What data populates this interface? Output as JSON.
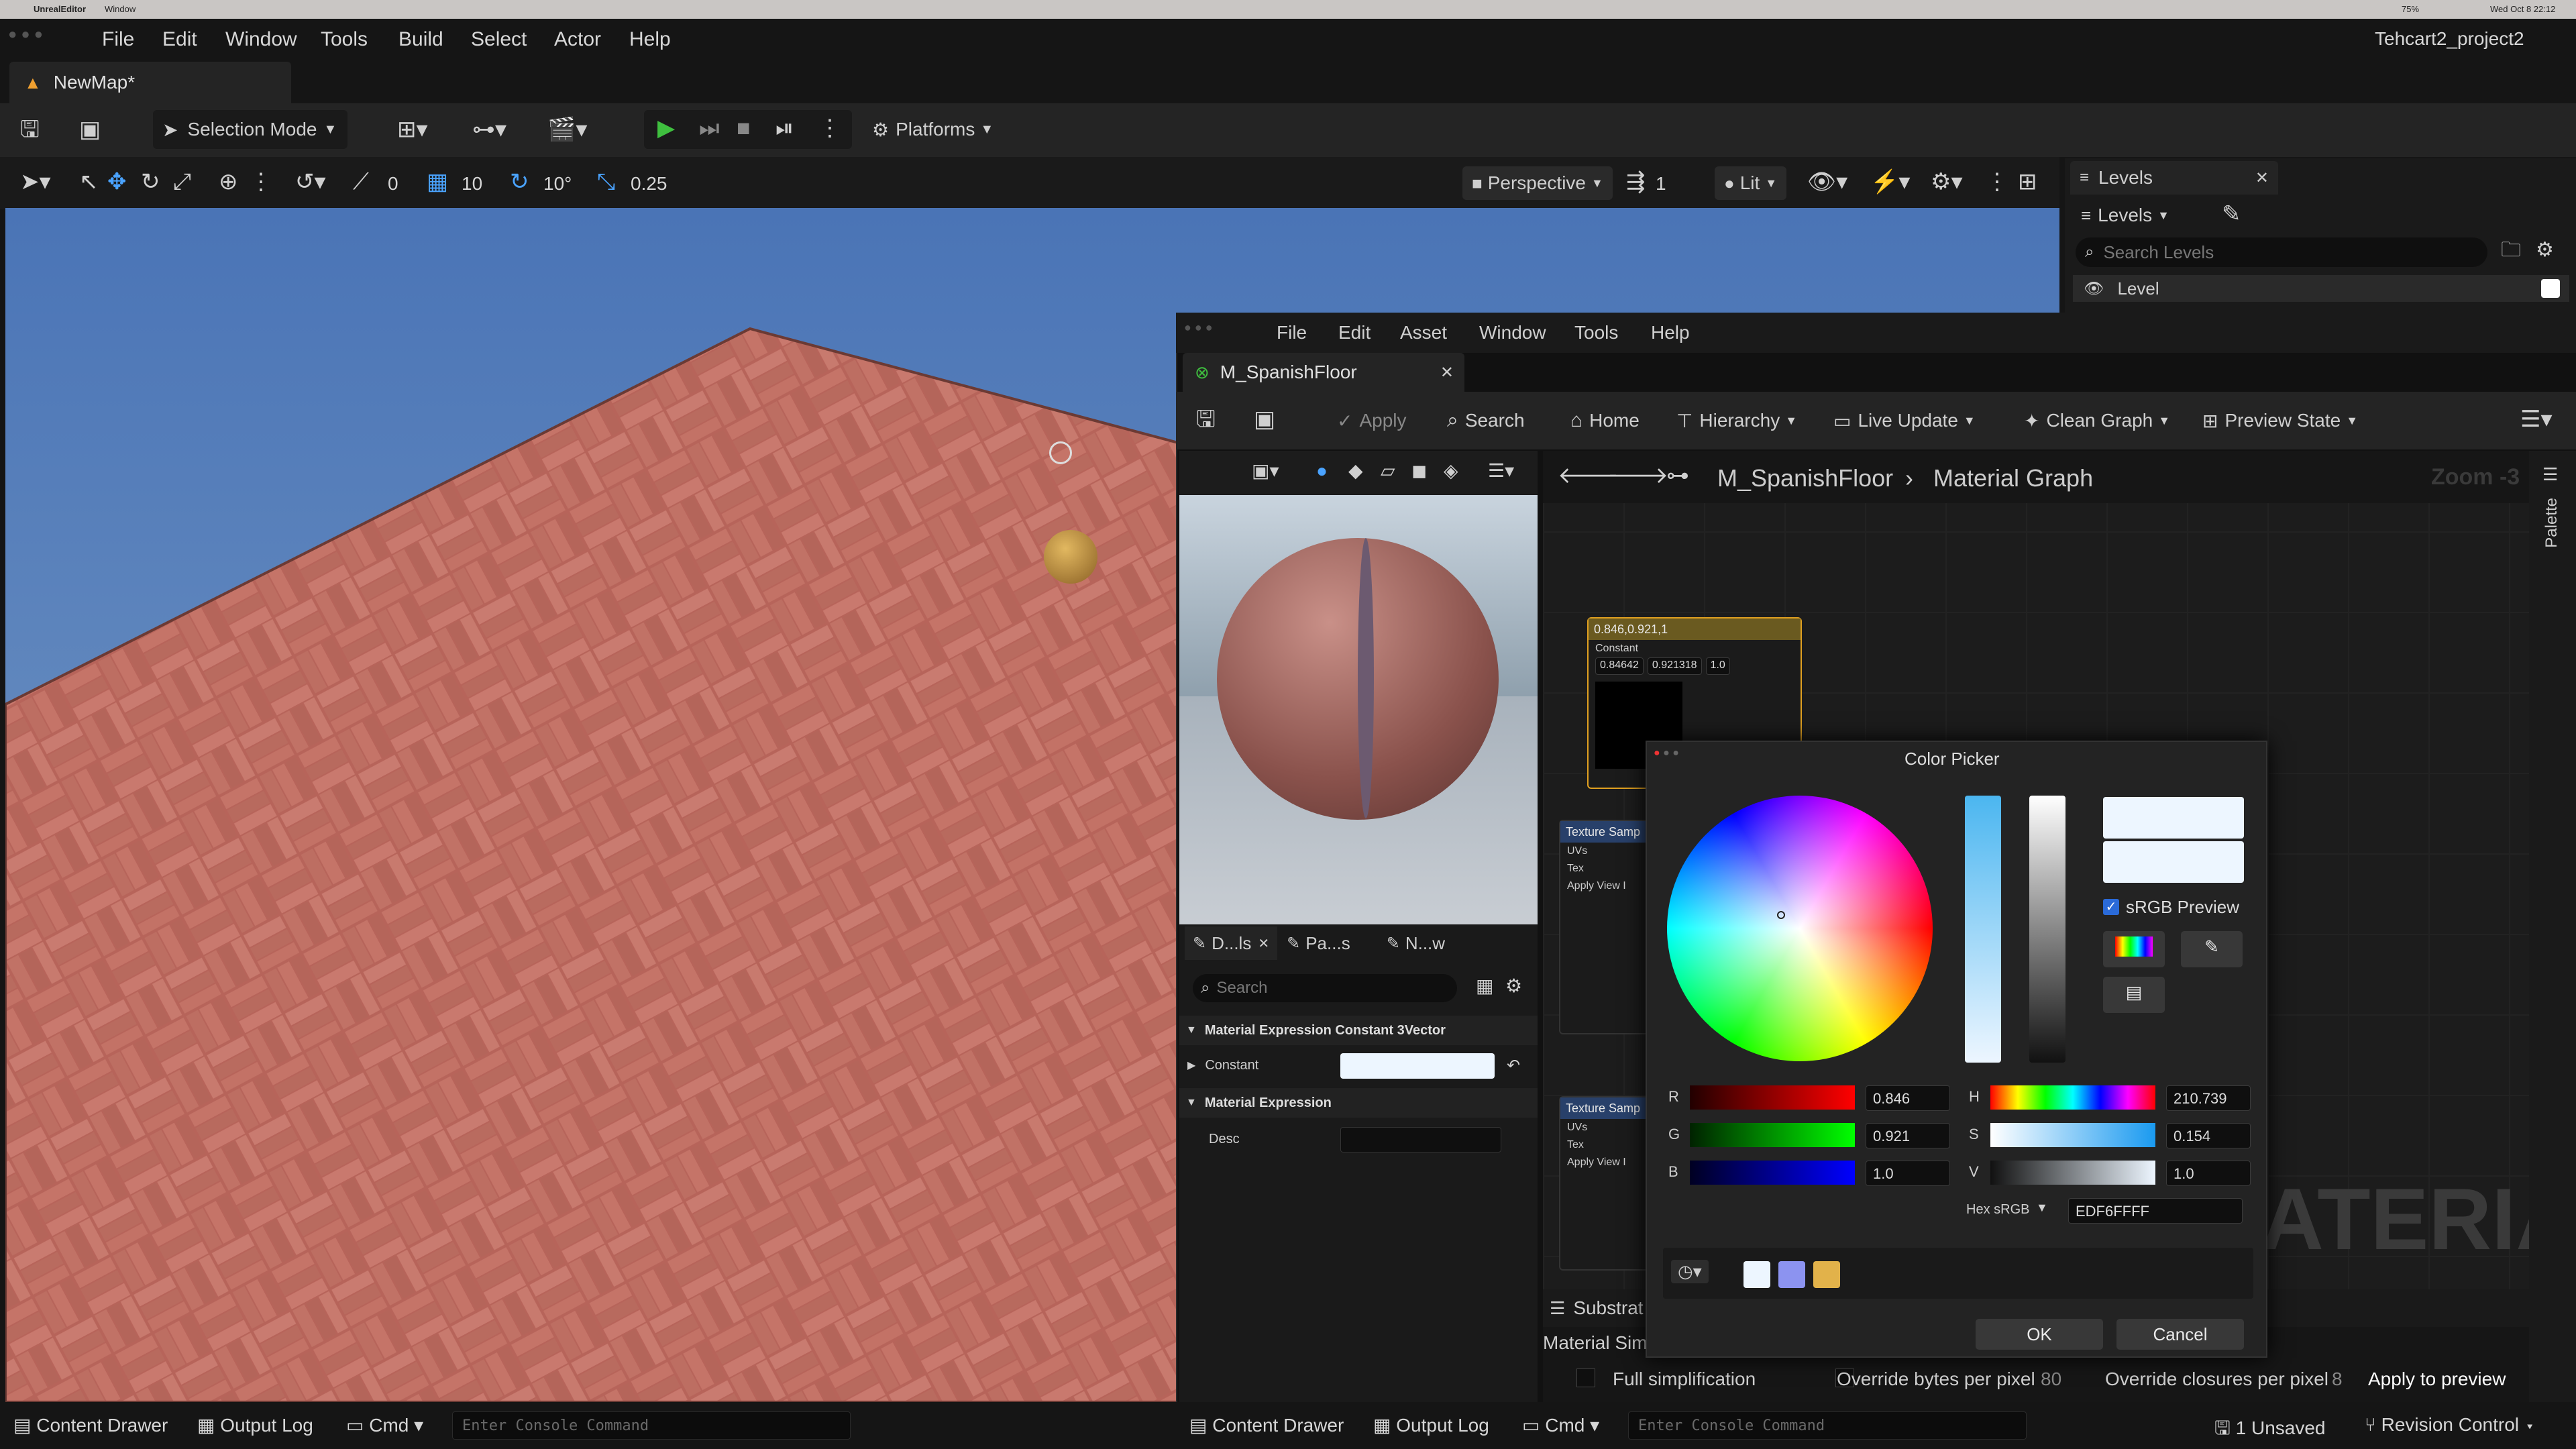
{
  "mac_bar": {
    "app": "UnrealEditor",
    "menu": "Window",
    "clock": "Wed Oct 8 22:12",
    "battery": "75%"
  },
  "main_menu": [
    "File",
    "Edit",
    "Window",
    "Tools",
    "Build",
    "Select",
    "Actor",
    "Help"
  ],
  "project_name": "Tehcart2_project2",
  "map_tab": "NewMap*",
  "toolbar": {
    "selection_mode": "Selection Mode",
    "platforms": "Platforms"
  },
  "viewport_toolbar": {
    "rotation_snap": "0",
    "grid_snap": "10",
    "angle_snap": "10°",
    "scale_snap": "0.25",
    "perspective": "Perspective",
    "camera_speed": "1",
    "view_mode": "Lit"
  },
  "levels_panel": {
    "tab": "Levels",
    "dropdown": "Levels",
    "search_placeholder": "Search Levels",
    "row": "Level"
  },
  "material_editor": {
    "menu": [
      "File",
      "Edit",
      "Asset",
      "Window",
      "Tools",
      "Help"
    ],
    "tab": "M_SpanishFloor",
    "toolbar": {
      "apply": "Apply",
      "search": "Search",
      "home": "Home",
      "hierarchy": "Hierarchy",
      "live_update": "Live Update",
      "clean_graph": "Clean Graph",
      "preview_state": "Preview State"
    },
    "breadcrumb": {
      "asset": "M_SpanishFloor",
      "graph": "Material Graph"
    },
    "zoom": "Zoom -3",
    "palette": "Palette",
    "details_tabs": [
      "D...ls",
      "Pa...s",
      "N...w"
    ],
    "details_search_placeholder": "Search",
    "section1": "Material Expression Constant 3Vector",
    "constant_label": "Constant",
    "section2": "Material Expression",
    "desc_label": "Desc",
    "node_constant": {
      "title": "0.846,0.921,1",
      "label": "Constant",
      "x": "0.84642",
      "y": "0.921318",
      "z": "1.0"
    },
    "node_tex1": {
      "title": "Texture Samp",
      "pins": [
        "UVs",
        "Tex",
        "Apply View I"
      ]
    },
    "node_tex2": {
      "title": "Texture Samp",
      "pins": [
        "UVs",
        "Tex",
        "Apply View I"
      ]
    },
    "watermark": "ATERIAL",
    "substrate_tab": "Substrat",
    "material_sim": "Material Sim",
    "bottom_row": {
      "full_simplification": "Full simplification",
      "override_bytes": "Override bytes per pixel",
      "override_bytes_value": "80",
      "override_closures": "Override closures per pixel",
      "override_closures_value": "8",
      "apply_preview": "Apply to preview"
    }
  },
  "color_picker": {
    "title": "Color Picker",
    "srgb_preview": "sRGB Preview",
    "r_label": "R",
    "r_value": "0.846",
    "g_label": "G",
    "g_value": "0.921",
    "b_label": "B",
    "b_value": "1.0",
    "h_label": "H",
    "h_value": "210.739",
    "s_label": "S",
    "s_value": "0.154",
    "v_label": "V",
    "v_value": "1.0",
    "hex_label": "Hex sRGB",
    "hex_value": "EDF6FFFF",
    "ok": "OK",
    "cancel": "Cancel",
    "swatches": [
      "#edf6ff",
      "#8c93f0",
      "#e2b24a"
    ],
    "current_color": "#edf6ff"
  },
  "status_bar_left": {
    "content_drawer": "Content Drawer",
    "output_log": "Output Log",
    "cmd": "Cmd",
    "console_placeholder": "Enter Console Command"
  },
  "status_bar_right": {
    "content_drawer": "Content Drawer",
    "output_log": "Output Log",
    "cmd": "Cmd",
    "console_placeholder": "Enter Console Command",
    "unsaved": "1 Unsaved",
    "revision_control": "Revision Control"
  }
}
